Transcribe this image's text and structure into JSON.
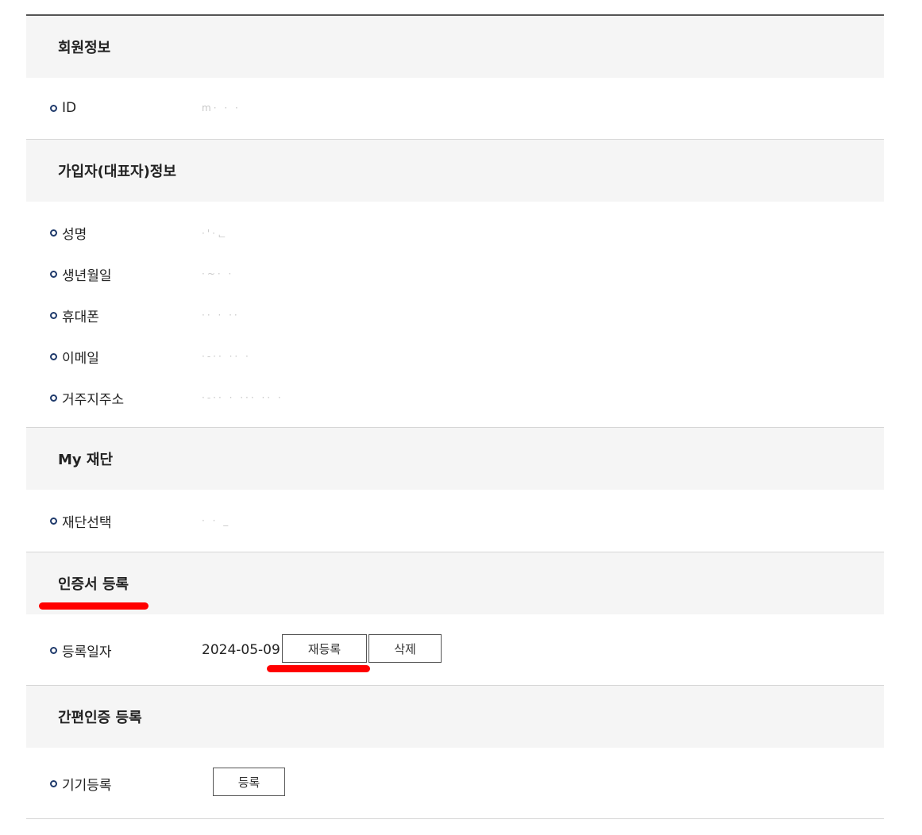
{
  "member_info": {
    "title": "회원정보",
    "fields": [
      {
        "label": "ID",
        "value": "m· ·  ·"
      }
    ]
  },
  "subscriber_info": {
    "title": "가입자(대표자)정보",
    "fields": [
      {
        "label": "성명",
        "value": "·'·ᆫ"
      },
      {
        "label": "생년월일",
        "value": "·~·        ·"
      },
      {
        "label": "휴대폰",
        "value": "·· ·        ··"
      },
      {
        "label": "이메일",
        "value": "·-·· ··  ·"
      },
      {
        "label": "거주지주소",
        "value": "·-·· ·      ··· ·· ·"
      }
    ]
  },
  "my_foundation": {
    "title": "My 재단",
    "fields": [
      {
        "label": "재단선택",
        "value": "·              ·  _"
      }
    ]
  },
  "certificate": {
    "title": "인증서 등록",
    "date_label": "등록일자",
    "date_value": "2024-05-09",
    "reregister_label": "재등록",
    "delete_label": "삭제"
  },
  "simple_auth": {
    "title": "간편인증 등록",
    "device_label": "기기등록",
    "register_label": "등록"
  },
  "colors": {
    "bullet": "#1f3a6b",
    "annotation_red": "#ff0000",
    "section_bg": "#f5f5f5"
  }
}
